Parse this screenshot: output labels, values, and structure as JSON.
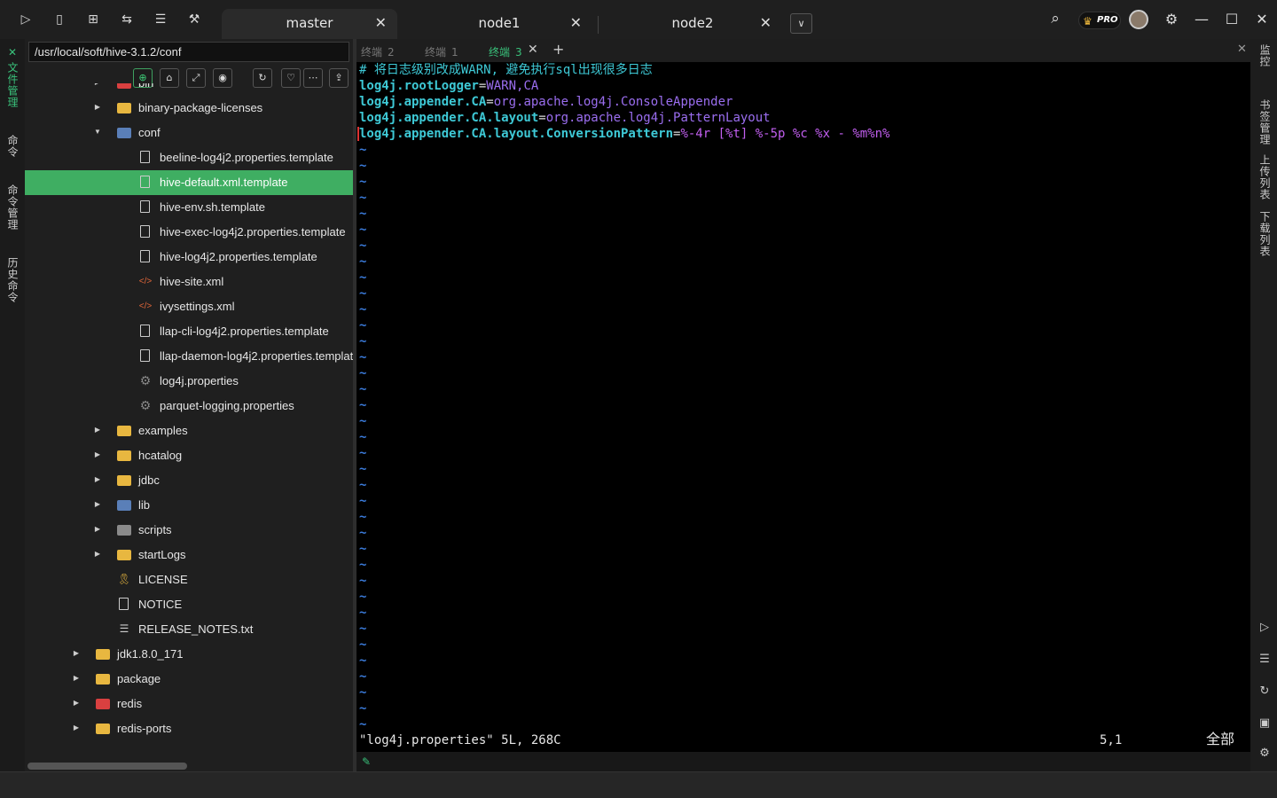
{
  "tabs": [
    {
      "label": "master",
      "active": true
    },
    {
      "label": "node1",
      "active": false
    },
    {
      "label": "node2",
      "active": false
    }
  ],
  "toolbar_icons": [
    "terminal-icon",
    "bookmark-icon",
    "grid-icon",
    "split-icon",
    "document-icon",
    "wrench-icon"
  ],
  "top_right": {
    "pro_label": "PRO"
  },
  "left_strip": {
    "items": [
      "文件管理",
      "命令",
      "命令管理",
      "历史命令"
    ]
  },
  "file_panel": {
    "path": "/usr/local/soft/hive-3.1.2/conf",
    "rows": [
      {
        "name": "bin",
        "type": "folder-red",
        "expanded": false
      },
      {
        "name": "binary-package-licenses",
        "type": "folder",
        "expanded": false
      },
      {
        "name": "conf",
        "type": "folder-blue",
        "expanded": true
      },
      {
        "name": "beeline-log4j2.properties.template",
        "type": "file"
      },
      {
        "name": "hive-default.xml.template",
        "type": "file",
        "selected": true
      },
      {
        "name": "hive-env.sh.template",
        "type": "file"
      },
      {
        "name": "hive-exec-log4j2.properties.template",
        "type": "file"
      },
      {
        "name": "hive-log4j2.properties.template",
        "type": "file"
      },
      {
        "name": "hive-site.xml",
        "type": "xml"
      },
      {
        "name": "ivysettings.xml",
        "type": "xml"
      },
      {
        "name": "llap-cli-log4j2.properties.template",
        "type": "file"
      },
      {
        "name": "llap-daemon-log4j2.properties.template",
        "type": "file"
      },
      {
        "name": "log4j.properties",
        "type": "gear"
      },
      {
        "name": "parquet-logging.properties",
        "type": "gear"
      },
      {
        "name": "examples",
        "type": "folder",
        "expanded": false
      },
      {
        "name": "hcatalog",
        "type": "folder",
        "expanded": false
      },
      {
        "name": "jdbc",
        "type": "folder",
        "expanded": false
      },
      {
        "name": "lib",
        "type": "folder-blue",
        "expanded": false
      },
      {
        "name": "scripts",
        "type": "folder-gray",
        "expanded": false
      },
      {
        "name": "startLogs",
        "type": "folder",
        "expanded": false
      },
      {
        "name": "LICENSE",
        "type": "license"
      },
      {
        "name": "NOTICE",
        "type": "file"
      },
      {
        "name": "RELEASE_NOTES.txt",
        "type": "text"
      },
      {
        "name": "jdk1.8.0_171",
        "type": "folder",
        "expanded": false
      },
      {
        "name": "package",
        "type": "folder",
        "expanded": false
      },
      {
        "name": "redis",
        "type": "folder-red",
        "expanded": false
      },
      {
        "name": "redis-ports",
        "type": "folder",
        "expanded": false
      }
    ]
  },
  "terminal_tabs": [
    {
      "label": "终端",
      "num": "2",
      "active": false
    },
    {
      "label": "终端",
      "num": "1",
      "active": false
    },
    {
      "label": "终端",
      "num": "3",
      "active": true
    }
  ],
  "terminal": {
    "comment": "# 将日志级别改成WARN, 避免执行sql出现很多日志",
    "lines": [
      {
        "key": "log4j.rootLogger",
        "value": "WARN,CA"
      },
      {
        "key": "log4j.appender.CA",
        "value": "org.apache.log4j.ConsoleAppender"
      },
      {
        "key": "log4j.appender.CA.layout",
        "value": "org.apache.log4j.PatternLayout"
      },
      {
        "key": "log4j.appender.CA.layout.ConversionPattern",
        "value": "%-4r [%t] %-5p %c %x - %m%n%"
      }
    ],
    "tilde": "~",
    "status_file": "\"log4j.properties\" 5L, 268C",
    "status_pos": "5,1",
    "status_all": "全部"
  },
  "right_strip": {
    "labels": [
      "监控",
      "书签管理",
      "上传列表",
      "下载列表"
    ]
  }
}
